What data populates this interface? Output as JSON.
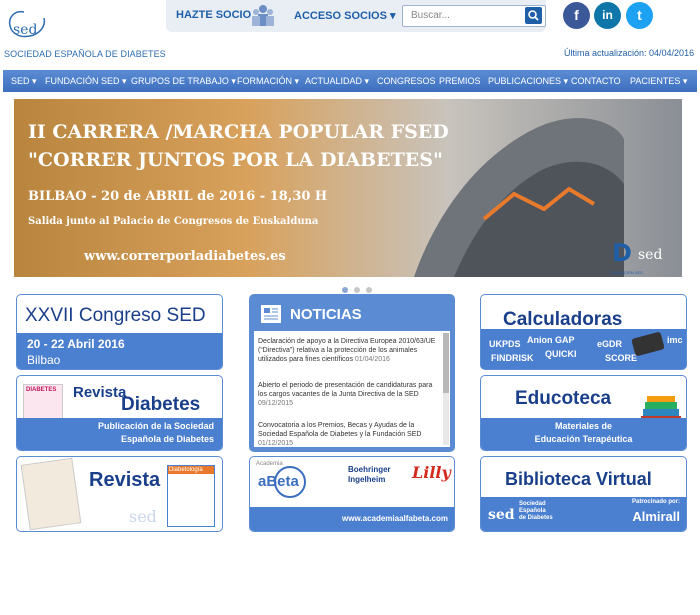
{
  "header": {
    "logo_text": "SOCIEDAD ESPAÑOLA DE DIABETES",
    "hazte_socio": "HAZTE SOCIO",
    "acceso_socios": "ACCESO SOCIOS",
    "search_placeholder": "Buscar...",
    "updated": "Última actualización: 04/04/2016",
    "social": [
      "f",
      "in",
      "t"
    ],
    "colors": {
      "brand": "#1f5fa8",
      "nav": "#4a7cc9"
    }
  },
  "nav": [
    "SED ▾",
    "FUNDACIÓN SED ▾",
    "GRUPOS DE TRABAJO ▾",
    "FORMACIÓN ▾",
    "ACTUALIDAD ▾",
    "CONGRESOS",
    "PREMIOS",
    "PUBLICACIONES ▾",
    "CONTACTO",
    "PACIENTES ▾"
  ],
  "banner": {
    "line1": "II CARRERA /MARCHA POPULAR FSED",
    "line2": "\"CORRER JUNTOS POR LA DIABETES\"",
    "line3": "BILBAO - 20 de ABRIL de 2016 - 18,30 H",
    "line4": "Salida junto al Palacio de Congresos de Euskalduna",
    "line5": "www.correrporladiabetes.es",
    "corner": "FUNDACIÓN SED"
  },
  "boxes": {
    "congreso": {
      "title": "XXVII Congreso SED",
      "dates": "20 - 22 Abril 2016",
      "city": "Bilbao"
    },
    "revista_diabetes": {
      "cover": "DIABETES",
      "word1": "Revista",
      "word2": "Diabetes",
      "sub1": "Publicación de la Sociedad",
      "sub2": "Española de Diabetes"
    },
    "revista": {
      "title": "Revista",
      "cover": "Diabetología"
    },
    "noticias": {
      "title": "NOTICIAS",
      "items": [
        {
          "text": "Declaración de apoyo a la Directiva Europea 2010/63/UE (“Directiva”) relativa a la protección de los animales utilizados para fines científicos",
          "date": "01/04/2016"
        },
        {
          "text": "Abierto el periodo de presentación de candidaturas para los cargos vacantes de la Junta Directiva de la SED",
          "date": "09/12/2015"
        },
        {
          "text": "Convocatoria a los Premios, Becas y Ayudas de la Sociedad Española de Diabetes y la Fundación SED",
          "date": "01/12/2015"
        }
      ]
    },
    "academia": {
      "small": "Academia",
      "name": "aBeta",
      "sponsor": "Boehringer Ingelheim",
      "lilly": "Lilly",
      "url": "www.academiaalfabeta.com"
    },
    "calculadoras": {
      "title": "Calculadoras",
      "tags": [
        "UKPDS",
        "Anion GAP",
        "QUICKI",
        "eGDR",
        "imc",
        "FINDRISK",
        "SCORE"
      ]
    },
    "educoteca": {
      "title": "Educoteca",
      "sub1": "Materiales de",
      "sub2": "Educación Terapéutica"
    },
    "biblioteca": {
      "title": "Biblioteca Virtual",
      "org1": "Sociedad",
      "org2": "Española",
      "org3": "de Diabetes",
      "patro": "Patrocinado por:",
      "sponsor": "Almirall"
    }
  }
}
